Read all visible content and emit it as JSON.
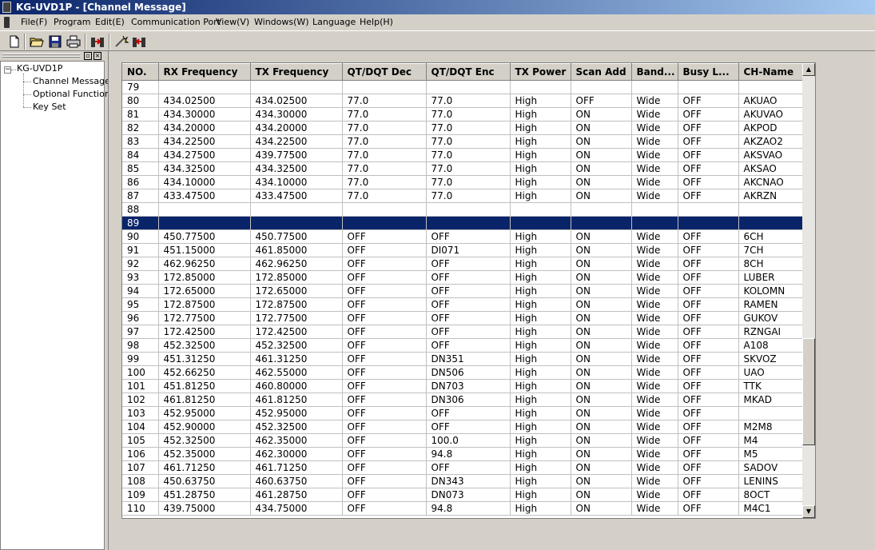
{
  "window": {
    "title": "KG-UVD1P - [Channel Message]"
  },
  "menu": [
    "File(F)",
    "Program",
    "Edit(E)",
    "Communication Port",
    "View(V)",
    "Windows(W)",
    "Language",
    "Help(H)"
  ],
  "toolbar": {
    "icons": [
      "new-file-icon",
      "open-folder-icon",
      "save-icon",
      "print-icon",
      "read-from-radio-icon",
      "settings-wizard-icon",
      "write-to-radio-icon"
    ]
  },
  "tree": {
    "root": "KG-UVD1P",
    "items": [
      "Channel Message",
      "Optional Functions",
      "Key Set"
    ]
  },
  "grid": {
    "columns": [
      "NO.",
      "RX Frequency",
      "TX Frequency",
      "QT/DQT Dec",
      "QT/DQT Enc",
      "TX Power",
      "Scan Add",
      "Band...",
      "Busy L...",
      "CH-Name"
    ],
    "selected_row": "89",
    "rows": [
      [
        "79",
        "",
        "",
        "",
        "",
        "",
        "",
        "",
        "",
        ""
      ],
      [
        "80",
        "434.02500",
        "434.02500",
        "77.0",
        "77.0",
        "High",
        "OFF",
        "Wide",
        "OFF",
        "AKUAO"
      ],
      [
        "81",
        "434.30000",
        "434.30000",
        "77.0",
        "77.0",
        "High",
        "ON",
        "Wide",
        "OFF",
        "AKUVAO"
      ],
      [
        "82",
        "434.20000",
        "434.20000",
        "77.0",
        "77.0",
        "High",
        "ON",
        "Wide",
        "OFF",
        "AKPOD"
      ],
      [
        "83",
        "434.22500",
        "434.22500",
        "77.0",
        "77.0",
        "High",
        "ON",
        "Wide",
        "OFF",
        "AKZAO2"
      ],
      [
        "84",
        "434.27500",
        "439.77500",
        "77.0",
        "77.0",
        "High",
        "ON",
        "Wide",
        "OFF",
        "AKSVAO"
      ],
      [
        "85",
        "434.32500",
        "434.32500",
        "77.0",
        "77.0",
        "High",
        "ON",
        "Wide",
        "OFF",
        "AKSAO"
      ],
      [
        "86",
        "434.10000",
        "434.10000",
        "77.0",
        "77.0",
        "High",
        "ON",
        "Wide",
        "OFF",
        "AKCNAO"
      ],
      [
        "87",
        "433.47500",
        "433.47500",
        "77.0",
        "77.0",
        "High",
        "ON",
        "Wide",
        "OFF",
        "AKRZN"
      ],
      [
        "88",
        "",
        "",
        "",
        "",
        "",
        "",
        "",
        "",
        ""
      ],
      [
        "89",
        "",
        "",
        "",
        "",
        "",
        "",
        "",
        "",
        ""
      ],
      [
        "90",
        "450.77500",
        "450.77500",
        "OFF",
        "OFF",
        "High",
        "ON",
        "Wide",
        "OFF",
        "6CH"
      ],
      [
        "91",
        "451.15000",
        "461.85000",
        "OFF",
        "DI071",
        "High",
        "ON",
        "Wide",
        "OFF",
        "7CH"
      ],
      [
        "92",
        "462.96250",
        "462.96250",
        "OFF",
        "OFF",
        "High",
        "ON",
        "Wide",
        "OFF",
        "8CH"
      ],
      [
        "93",
        "172.85000",
        "172.85000",
        "OFF",
        "OFF",
        "High",
        "ON",
        "Wide",
        "OFF",
        "LUBER"
      ],
      [
        "94",
        "172.65000",
        "172.65000",
        "OFF",
        "OFF",
        "High",
        "ON",
        "Wide",
        "OFF",
        "KOLOMN"
      ],
      [
        "95",
        "172.87500",
        "172.87500",
        "OFF",
        "OFF",
        "High",
        "ON",
        "Wide",
        "OFF",
        "RAMEN"
      ],
      [
        "96",
        "172.77500",
        "172.77500",
        "OFF",
        "OFF",
        "High",
        "ON",
        "Wide",
        "OFF",
        "GUKOV"
      ],
      [
        "97",
        "172.42500",
        "172.42500",
        "OFF",
        "OFF",
        "High",
        "ON",
        "Wide",
        "OFF",
        "RZNGAI"
      ],
      [
        "98",
        "452.32500",
        "452.32500",
        "OFF",
        "OFF",
        "High",
        "ON",
        "Wide",
        "OFF",
        "A108"
      ],
      [
        "99",
        "451.31250",
        "461.31250",
        "OFF",
        "DN351",
        "High",
        "ON",
        "Wide",
        "OFF",
        "SKVOZ"
      ],
      [
        "100",
        "452.66250",
        "462.55000",
        "OFF",
        "DN506",
        "High",
        "ON",
        "Wide",
        "OFF",
        "UAO"
      ],
      [
        "101",
        "451.81250",
        "460.80000",
        "OFF",
        "DN703",
        "High",
        "ON",
        "Wide",
        "OFF",
        "TTK"
      ],
      [
        "102",
        "461.81250",
        "461.81250",
        "OFF",
        "DN306",
        "High",
        "ON",
        "Wide",
        "OFF",
        "MKAD"
      ],
      [
        "103",
        "452.95000",
        "452.95000",
        "OFF",
        "OFF",
        "High",
        "ON",
        "Wide",
        "OFF",
        ""
      ],
      [
        "104",
        "452.90000",
        "452.32500",
        "OFF",
        "OFF",
        "High",
        "ON",
        "Wide",
        "OFF",
        "M2M8"
      ],
      [
        "105",
        "452.32500",
        "462.35000",
        "OFF",
        "100.0",
        "High",
        "ON",
        "Wide",
        "OFF",
        "M4"
      ],
      [
        "106",
        "452.35000",
        "462.30000",
        "OFF",
        "94.8",
        "High",
        "ON",
        "Wide",
        "OFF",
        "M5"
      ],
      [
        "107",
        "461.71250",
        "461.71250",
        "OFF",
        "OFF",
        "High",
        "ON",
        "Wide",
        "OFF",
        "SADOV"
      ],
      [
        "108",
        "450.63750",
        "460.63750",
        "OFF",
        "DN343",
        "High",
        "ON",
        "Wide",
        "OFF",
        "LENINS"
      ],
      [
        "109",
        "451.28750",
        "461.28750",
        "OFF",
        "DN073",
        "High",
        "ON",
        "Wide",
        "OFF",
        "8OCT"
      ],
      [
        "110",
        "439.75000",
        "434.75000",
        "OFF",
        "94.8",
        "High",
        "ON",
        "Wide",
        "OFF",
        "M4C1"
      ]
    ]
  }
}
